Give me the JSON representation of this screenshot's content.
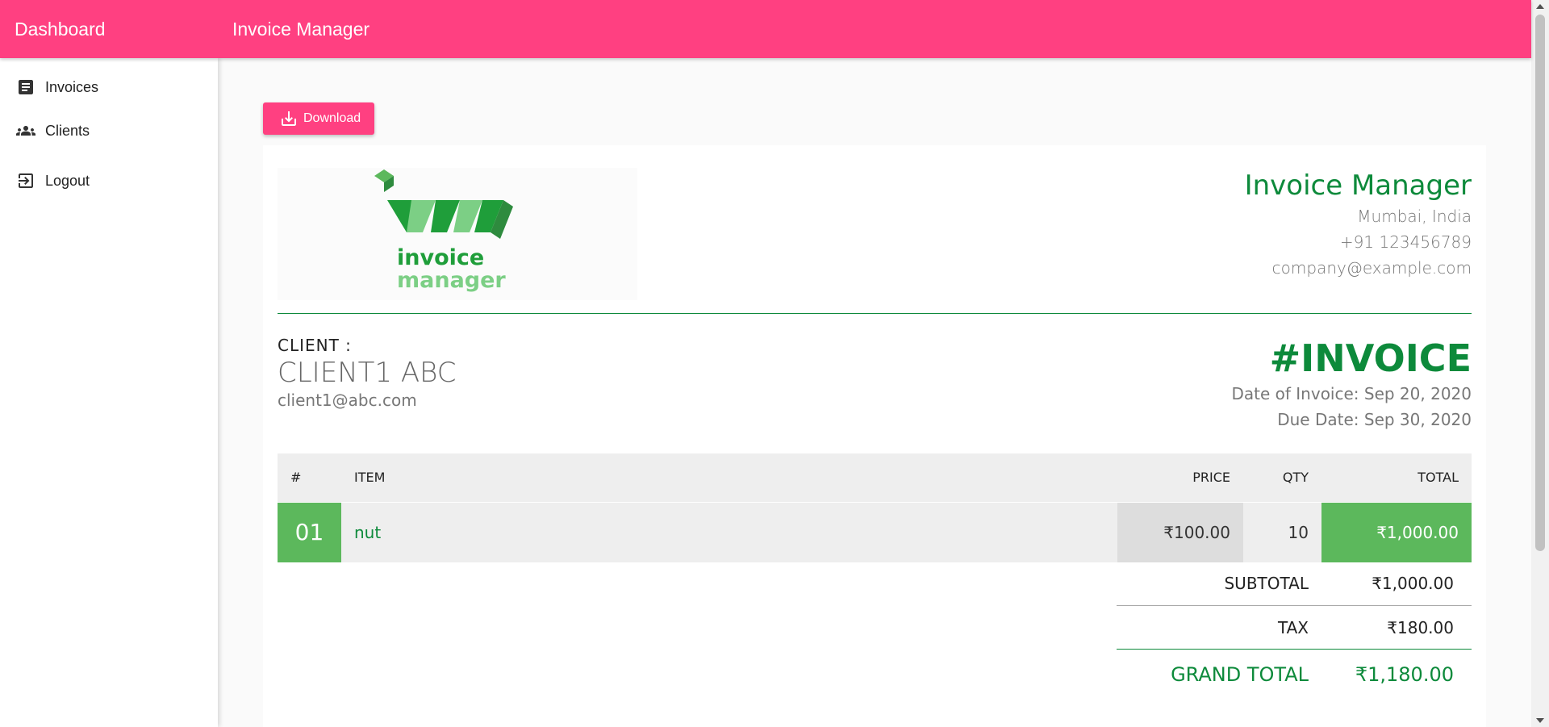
{
  "header": {
    "brand": "Dashboard",
    "title": "Invoice Manager",
    "color": "#ff4081"
  },
  "sidebar": {
    "items": [
      {
        "label": "Invoices",
        "icon": "invoice-document-icon"
      },
      {
        "label": "Clients",
        "icon": "people-group-icon"
      },
      {
        "label": "Logout",
        "icon": "logout-icon"
      }
    ]
  },
  "toolbar": {
    "download_label": "Download",
    "download_icon": "download-icon"
  },
  "logo": {
    "line1": "invoice",
    "line2": "manager"
  },
  "company": {
    "name": "Invoice Manager",
    "address": "Mumbai, India",
    "phone": "+91 123456789",
    "email": "company@example.com"
  },
  "client": {
    "label": "CLIENT :",
    "name": "CLIENT1 ABC",
    "email": "client1@abc.com"
  },
  "invoice": {
    "title": "#INVOICE",
    "date": "Date of Invoice: Sep 20, 2020",
    "due": "Due Date: Sep 30, 2020"
  },
  "table": {
    "headers": {
      "num": "#",
      "item": "ITEM",
      "price": "PRICE",
      "qty": "QTY",
      "total": "TOTAL"
    },
    "rows": [
      {
        "num": "01",
        "item": "nut",
        "price": "₹100.00",
        "qty": "10",
        "total": "₹1,000.00"
      }
    ]
  },
  "totals": {
    "subtotal_label": "SUBTOTAL",
    "subtotal": "₹1,000.00",
    "tax_label": "TAX",
    "tax": "₹180.00",
    "grand_label": "GRAND TOTAL",
    "grand": "₹1,180.00"
  },
  "colors": {
    "accent": "#ff4081",
    "green": "#0d8a3b",
    "row_green": "#5cb85c"
  }
}
